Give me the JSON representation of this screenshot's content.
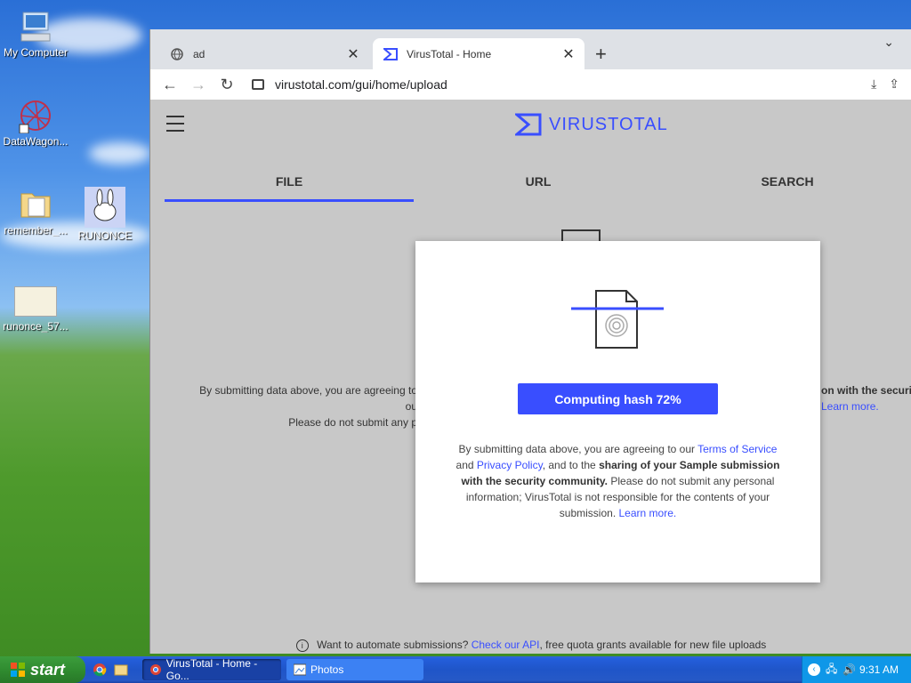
{
  "desktop": {
    "icons": [
      {
        "label": "My Computer"
      },
      {
        "label": "DataWagon..."
      },
      {
        "label": "remember_..."
      },
      {
        "label": "RUNONCE"
      },
      {
        "label": "runonce_57..."
      }
    ]
  },
  "browser": {
    "tabs": [
      {
        "title": "ad",
        "icon": "globe-icon"
      },
      {
        "title": "VirusTotal - Home",
        "icon": "virustotal-icon"
      }
    ],
    "url": "virustotal.com/gui/home/upload"
  },
  "page": {
    "logo_text": "VIRUSTOTAL",
    "tabs": [
      "FILE",
      "URL",
      "SEARCH"
    ],
    "bg_left_line1": "By submitting data above, you are agreeing to ou",
    "bg_left_line2": "Please do not submit any p",
    "bg_right_line1": "on with the securit",
    "bg_right_line2": "Learn more.",
    "api_text": "Want to automate submissions?",
    "api_link": "Check our API",
    "api_rest": ", free quota grants available for new file uploads"
  },
  "modal": {
    "button_label": "Computing hash 72%",
    "progress_percent": 72,
    "text": {
      "t1": "By submitting data above, you are agreeing to our ",
      "tos": "Terms of Service",
      "t2": "and ",
      "privacy": "Privacy Policy",
      "t3": ", and to the ",
      "bold": "sharing of your Sample submission with the security community.",
      "t4": " Please do not submit any personal information; VirusTotal is not responsible for the contents of your submission. ",
      "learn": "Learn more."
    }
  },
  "taskbar": {
    "start_label": "start",
    "tasks": [
      {
        "label": "VirusTotal - Home - Go...",
        "icon": "chrome-icon"
      },
      {
        "label": "Photos",
        "icon": "photos-icon"
      }
    ],
    "clock": "9:31 AM"
  },
  "colors": {
    "accent": "#394eff"
  }
}
